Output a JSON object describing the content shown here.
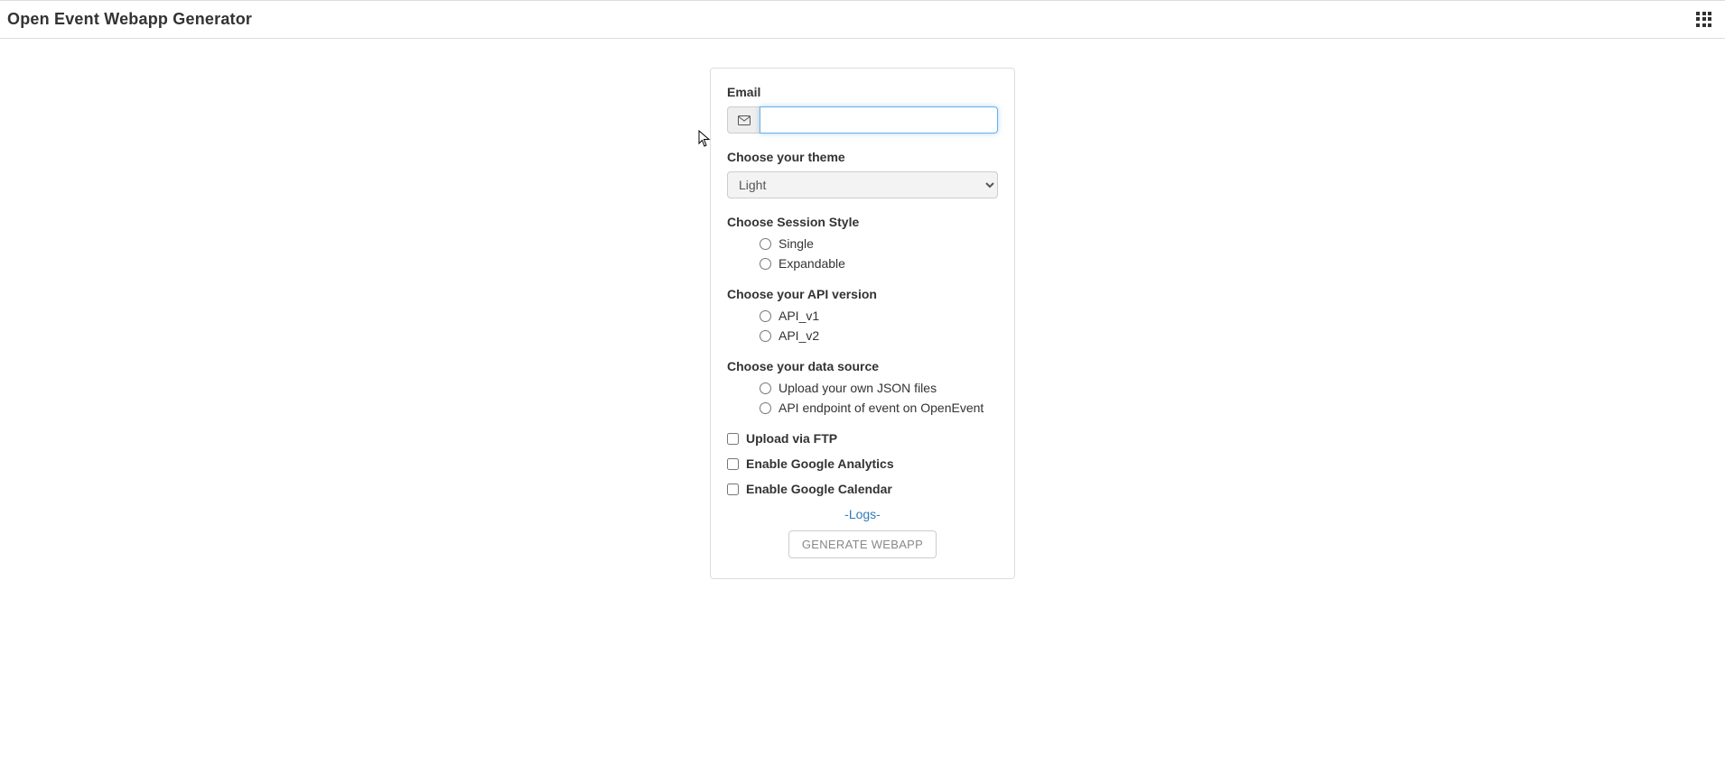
{
  "header": {
    "title": "Open Event Webapp Generator"
  },
  "form": {
    "email_label": "Email",
    "email_value": "",
    "theme_label": "Choose your theme",
    "theme_options": [
      "Light"
    ],
    "theme_selected": "Light",
    "session_style_label": "Choose Session Style",
    "session_style_options": [
      "Single",
      "Expandable"
    ],
    "api_version_label": "Choose your API version",
    "api_version_options": [
      "API_v1",
      "API_v2"
    ],
    "data_source_label": "Choose your data source",
    "data_source_options": [
      "Upload your own JSON files",
      "API endpoint of event on OpenEvent"
    ],
    "toggles": {
      "ftp": "Upload via FTP",
      "ga": "Enable Google Analytics",
      "gcal": "Enable Google Calendar"
    },
    "logs_link": "-Logs-",
    "submit_label": "GENERATE WEBAPP"
  }
}
